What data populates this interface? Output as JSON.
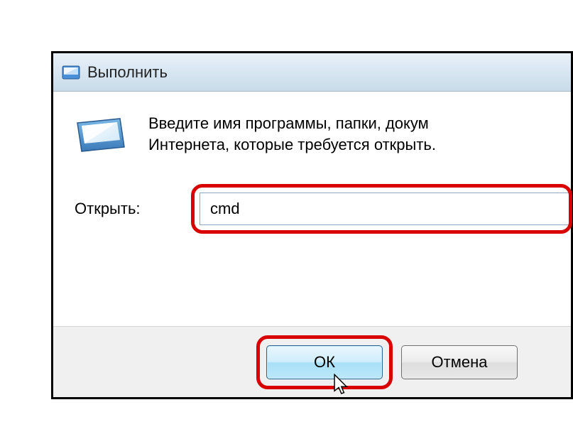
{
  "dialog": {
    "title": "Выполнить",
    "description_line1": "Введите имя программы, папки, докум",
    "description_line2": "Интернета, которые требуется открыть.",
    "open_label": "Открыть:",
    "open_value": "cmd",
    "ok_label": "ОК",
    "cancel_label": "Отмена"
  },
  "icons": {
    "titlebar": "run-icon",
    "main": "run-icon"
  }
}
